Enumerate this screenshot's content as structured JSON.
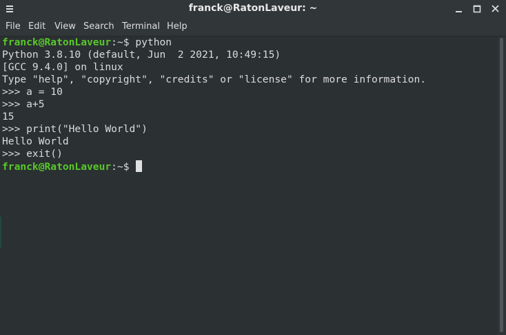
{
  "window": {
    "title": "franck@RatonLaveur: ~",
    "controls": {
      "minimize": "minimize-icon",
      "maximize": "maximize-icon",
      "close": "close-icon"
    }
  },
  "menubar": {
    "items": [
      "File",
      "Edit",
      "View",
      "Search",
      "Terminal",
      "Help"
    ]
  },
  "terminal": {
    "prompt_user": "franck@RatonLaveur",
    "prompt_sep": ":",
    "prompt_path": "~",
    "prompt_sym": "$",
    "command1": " python",
    "output": [
      "Python 3.8.10 (default, Jun  2 2021, 10:49:15)",
      "[GCC 9.4.0] on linux",
      "Type \"help\", \"copyright\", \"credits\" or \"license\" for more information.",
      ">>> a = 10",
      ">>> a+5",
      "15",
      ">>> print(\"Hello World\")",
      "Hello World",
      ">>> exit()"
    ]
  },
  "colors": {
    "background": "#2b3033",
    "prompt": "#58c828",
    "text": "#dcdcdc"
  }
}
